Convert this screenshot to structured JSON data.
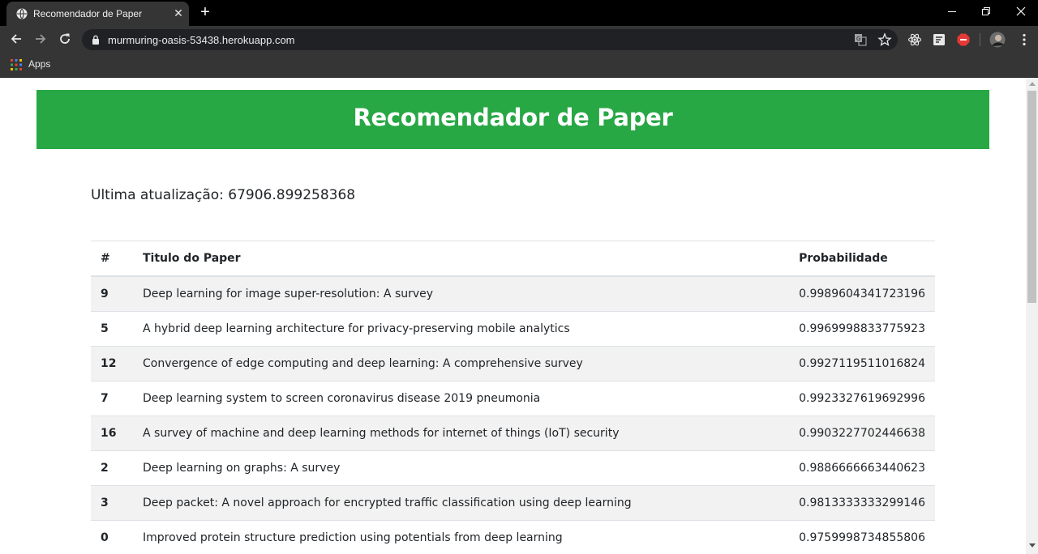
{
  "browser": {
    "tab_title": "Recomendador de Paper",
    "url": "murmuring-oasis-53438.herokuapp.com",
    "bookmarks": {
      "apps_label": "Apps"
    }
  },
  "page": {
    "banner_title": "Recomendador de Paper",
    "update_label": "Ultima atualização:",
    "update_value": "67906.899258368",
    "table": {
      "headers": {
        "index": "#",
        "title": "Titulo do Paper",
        "probability": "Probabilidade"
      },
      "rows": [
        {
          "index": "9",
          "title": "Deep learning for image super-resolution: A survey",
          "probability": "0.9989604341723196"
        },
        {
          "index": "5",
          "title": "A hybrid deep learning architecture for privacy-preserving mobile analytics",
          "probability": "0.9969998833775923"
        },
        {
          "index": "12",
          "title": "Convergence of edge computing and deep learning: A comprehensive survey",
          "probability": "0.9927119511016824"
        },
        {
          "index": "7",
          "title": "Deep learning system to screen coronavirus disease 2019 pneumonia",
          "probability": "0.9923327619692996"
        },
        {
          "index": "16",
          "title": "A survey of machine and deep learning methods for internet of things (IoT) security",
          "probability": "0.9903227702446638"
        },
        {
          "index": "2",
          "title": "Deep learning on graphs: A survey",
          "probability": "0.9886666663440623"
        },
        {
          "index": "3",
          "title": "Deep packet: A novel approach for encrypted traffic classification using deep learning",
          "probability": "0.9813333333299146"
        },
        {
          "index": "0",
          "title": "Improved protein structure prediction using potentials from deep learning",
          "probability": "0.9759998734855806"
        }
      ]
    }
  },
  "colors": {
    "banner": "#28a745",
    "striped_row": "#f2f2f2",
    "chrome_dark": "#353535"
  },
  "icons": [
    "globe-icon",
    "close-icon",
    "plus-icon",
    "minimize-icon",
    "restore-icon",
    "back-icon",
    "forward-icon",
    "reload-icon",
    "lock-icon",
    "translate-icon",
    "star-icon",
    "react-devtools-icon",
    "extension-icon",
    "adblock-icon",
    "avatar",
    "menu-kebab-icon",
    "apps-grid-icon"
  ]
}
